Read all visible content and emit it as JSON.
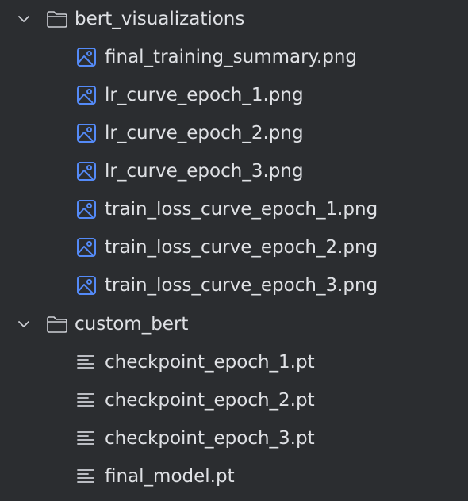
{
  "tree": {
    "folders": [
      {
        "name": "bert_visualizations",
        "expanded": true,
        "chevron_icon": "chevron-down-icon",
        "folder_icon": "folder-icon",
        "files": [
          {
            "name": "final_training_summary.png",
            "icon": "image-file-icon"
          },
          {
            "name": "lr_curve_epoch_1.png",
            "icon": "image-file-icon"
          },
          {
            "name": "lr_curve_epoch_2.png",
            "icon": "image-file-icon"
          },
          {
            "name": "lr_curve_epoch_3.png",
            "icon": "image-file-icon"
          },
          {
            "name": "train_loss_curve_epoch_1.png",
            "icon": "image-file-icon"
          },
          {
            "name": "train_loss_curve_epoch_2.png",
            "icon": "image-file-icon"
          },
          {
            "name": "train_loss_curve_epoch_3.png",
            "icon": "image-file-icon"
          }
        ]
      },
      {
        "name": "custom_bert",
        "expanded": true,
        "chevron_icon": "chevron-down-icon",
        "folder_icon": "folder-icon",
        "files": [
          {
            "name": "checkpoint_epoch_1.pt",
            "icon": "text-file-icon"
          },
          {
            "name": "checkpoint_epoch_2.pt",
            "icon": "text-file-icon"
          },
          {
            "name": "checkpoint_epoch_3.pt",
            "icon": "text-file-icon"
          },
          {
            "name": "final_model.pt",
            "icon": "text-file-icon"
          }
        ]
      }
    ]
  },
  "colors": {
    "background": "#2b2d30",
    "text": "#dfe1e5",
    "icon_gray": "#ced0d6",
    "image_icon_blue": "#548af7"
  }
}
